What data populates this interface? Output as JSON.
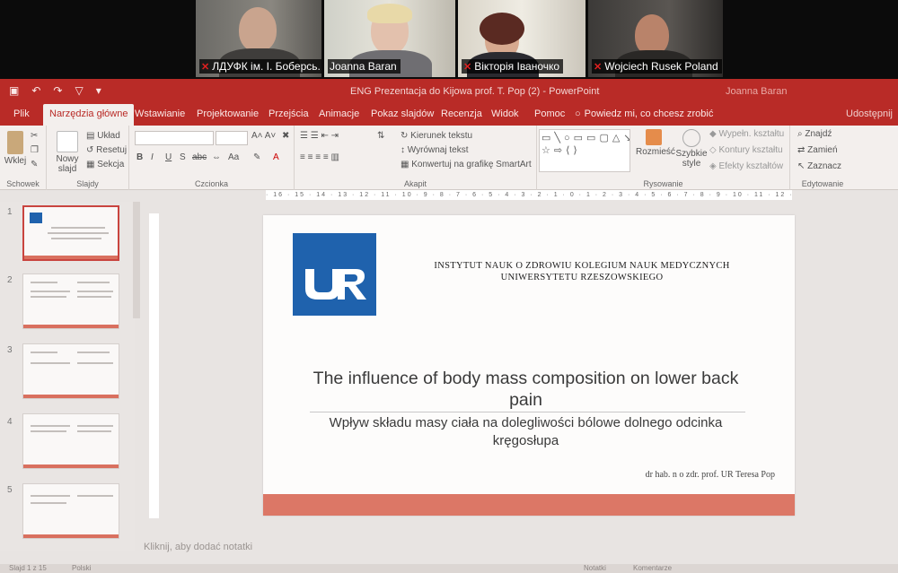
{
  "video_call": {
    "participants": [
      {
        "name": "ЛДУФК ім. І. Боберсь...",
        "muted": true,
        "active": false
      },
      {
        "name": "Joanna Baran",
        "muted": false,
        "active": true
      },
      {
        "name": "Вікторія Іваночко",
        "muted": true,
        "active": false
      },
      {
        "name": "Wojciech Rusek Poland",
        "muted": true,
        "active": false
      }
    ]
  },
  "window": {
    "doc_title": "ENG Prezentacja do Kijowa prof. T. Pop (2)  -  PowerPoint",
    "user": "Joanna Baran"
  },
  "tabs": [
    "Plik",
    "Narzędzia główne",
    "Wstawianie",
    "Projektowanie",
    "Przejścia",
    "Animacje",
    "Pokaz slajdów",
    "Recenzja",
    "Widok",
    "Pomoc"
  ],
  "tell_me": "Powiedz mi, co chcesz zrobić",
  "share": "Udostępnij",
  "ribbon": {
    "clipboard": {
      "paste": "Wklej",
      "label": "Schowek"
    },
    "slides": {
      "new_slide": "Nowy slajd",
      "layout": "Układ",
      "reset": "Resetuj",
      "section": "Sekcja",
      "label": "Slajdy"
    },
    "font": {
      "label": "Czcionka",
      "bold": "B",
      "italic": "I",
      "underline": "U",
      "shadow": "S",
      "strike": "abc",
      "case": "Aa"
    },
    "paragraph": {
      "text_direction": "Kierunek tekstu",
      "align_text": "Wyrównaj tekst",
      "smartart": "Konwertuj na grafikę SmartArt",
      "label": "Akapit"
    },
    "drawing": {
      "arrange": "Rozmieść",
      "quick_styles": "Szybkie style",
      "fill": "Wypełn. kształtu",
      "outline": "Kontury kształtu",
      "effects": "Efekty kształtów",
      "label": "Rysowanie"
    },
    "editing": {
      "find": "Znajdź",
      "replace": "Zamień",
      "select": "Zaznacz",
      "label": "Edytowanie"
    }
  },
  "ruler": "· 16 · 15 · 14 · 13 · 12 · 11 · 10 · 9 · 8 · 7 · 6 · 5 · 4 · 3 · 2 · 1 · 0 · 1 · 2 · 3 · 4 · 5 · 6 · 7 · 8 · 9 · 10 · 11 · 12 · 13 · 14 · 15 · 16 ·",
  "slide_numbers": [
    "1",
    "2",
    "3",
    "4",
    "5"
  ],
  "slide": {
    "institute_line1": "INSTYTUT NAUK O ZDROWIU KOLEGIUM NAUK MEDYCZNYCH",
    "institute_line2": "UNIWERSYTETU RZESZOWSKIEGO",
    "logo_text": "UR",
    "title_en": "The influence of body mass composition on lower back pain",
    "title_pl": "Wpływ składu masy ciała na dolegliwości bólowe dolnego odcinka kręgosłupa",
    "author": "dr hab. n o zdr. prof. UR Teresa Pop"
  },
  "notes_placeholder": "Kliknij, aby dodać notatki",
  "status": {
    "slide": "Slajd 1 z 15",
    "lang": "Polski",
    "notes": "Notatki",
    "comments": "Komentarze"
  }
}
